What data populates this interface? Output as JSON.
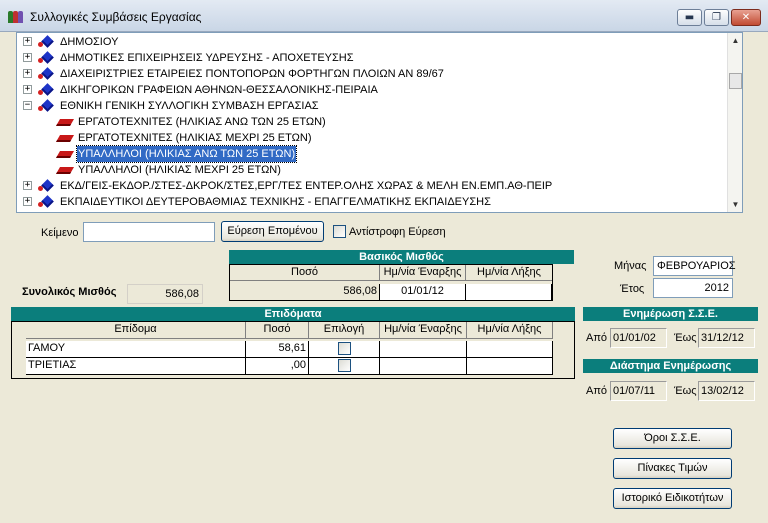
{
  "window": {
    "title": "Συλλογικές Συμβάσεις Εργασίας",
    "minimize": "▬",
    "restore": "❐",
    "close": "✕"
  },
  "tree": {
    "rows": [
      {
        "expander": "+",
        "icon": "diamond-icon",
        "label": "ΔΗΜΟΣΙΟΥ"
      },
      {
        "expander": "+",
        "icon": "diamond-icon",
        "label": "ΔΗΜΟΤΙΚΕΣ ΕΠΙΧΕΙΡΗΣΕΙΣ ΥΔΡΕΥΣΗΣ - ΑΠΟΧΕΤΕΥΣΗΣ"
      },
      {
        "expander": "+",
        "icon": "diamond-icon",
        "label": "ΔΙΑΧΕΙΡΙΣΤΡΙΕΣ ΕΤΑΙΡΕΙΕΣ ΠΟΝΤΟΠΟΡΩΝ ΦΟΡΤΗΓΩΝ ΠΛΟΙΩΝ ΑΝ 89/67"
      },
      {
        "expander": "+",
        "icon": "diamond-icon",
        "label": "ΔΙΚΗΓΟΡΙΚΩΝ ΓΡΑΦΕΙΩΝ ΑΘΗΝΩΝ-ΘΕΣΣΑΛΟΝΙΚΗΣ-ΠΕΙΡΑΙΑ"
      },
      {
        "expander": "−",
        "icon": "diamond-icon",
        "label": "ΕΘΝΙΚΗ ΓΕΝΙΚΗ ΣΥΛΛΟΓΙΚΗ ΣΥΜΒΑΣΗ ΕΡΓΑΣΙΑΣ"
      },
      {
        "expander": "",
        "icon": "book-icon",
        "label": "ΕΡΓΑΤΟΤΕΧΝΙΤΕΣ (ΗΛΙΚΙΑΣ ΑΝΩ ΤΩΝ 25 ΕΤΩΝ)"
      },
      {
        "expander": "",
        "icon": "book-icon",
        "label": "ΕΡΓΑΤΟΤΕΧΝΙΤΕΣ (ΗΛΙΚΙΑΣ ΜΕΧΡΙ 25 ΕΤΩΝ)"
      },
      {
        "expander": "",
        "icon": "book-icon",
        "label": "ΥΠΑΛΛΗΛΟΙ (ΗΛΙΚΙΑΣ ΑΝΩ ΤΩΝ 25 ΕΤΩΝ)",
        "selected": true
      },
      {
        "expander": "",
        "icon": "book-icon",
        "label": "ΥΠΑΛΛΗΛΟΙ (ΗΛΙΚΙΑΣ ΜΕΧΡΙ 25 ΕΤΩΝ)"
      },
      {
        "expander": "+",
        "icon": "diamond-icon",
        "label": "ΕΚΔ/ΓΕΙΣ-ΕΚΔΟΡ./ΣΤΕΣ-ΔΚΡΟΚ/ΣΤΕΣ,ΕΡΓ/ΤΕΣ ΕΝΤΕΡ.ΟΛΗΣ ΧΩΡΑΣ & ΜΕΛΗ ΕΝ.ΕΜΠ.ΑΘ-ΠΕΙΡ"
      },
      {
        "expander": "+",
        "icon": "diamond-icon",
        "label": "ΕΚΠΑΙΔΕΥΤΙΚΟΙ ΔΕΥΤΕΡΟΒΑΘΜΙΑΣ ΤΕΧΝΙΚΗΣ - ΕΠΑΓΓΕΛΜΑΤΙΚΗΣ ΕΚΠΑΙΔΕΥΣΗΣ"
      }
    ],
    "scroll_up": "▲",
    "scroll_down": "▼"
  },
  "search": {
    "label": "Κείμενο",
    "value": "",
    "find_next": "Εύρεση Επομένου",
    "reverse_label": "Αντίστροφη Εύρεση"
  },
  "total": {
    "label": "Συνολικός Μισθός",
    "value": "586,08"
  },
  "basic_salary": {
    "title": "Βασικός Μισθός",
    "headers": [
      "Ποσό",
      "Ημ/νία Έναρξης",
      "Ημ/νία Λήξης"
    ],
    "row": {
      "amount": "586,08",
      "start": "01/01/12",
      "end": ""
    }
  },
  "period": {
    "month_label": "Μήνας",
    "month_value": "ΦΕΒΡΟΥΑΡΙΟΣ",
    "year_label": "Έτος",
    "year_value": "2012"
  },
  "allowances": {
    "title": "Επιδόματα",
    "headers": [
      "Επίδομα",
      "Ποσό",
      "Επιλογή",
      "Ημ/νία Έναρξης",
      "Ημ/νία Λήξης"
    ],
    "rows": [
      {
        "name": "ΓΑΜΟΥ",
        "amount": "58,61",
        "start": "",
        "end": ""
      },
      {
        "name": "ΤΡΙΕΤΙΑΣ",
        "amount": ",00",
        "start": "",
        "end": ""
      }
    ]
  },
  "sse_update": {
    "title": "Ενημέρωση Σ.Σ.Ε.",
    "from_label": "Από",
    "from_value": "01/01/02",
    "to_label": "Έως",
    "to_value": "31/12/12"
  },
  "update_interval": {
    "title": "Διάστημα Ενημέρωσης",
    "from_label": "Από",
    "from_value": "01/07/11",
    "to_label": "Έως",
    "to_value": "13/02/12"
  },
  "buttons": {
    "terms": "Όροι Σ.Σ.Ε.",
    "price_tables": "Πίνακες Τιμών",
    "specialty_history": "Ιστορικό Ειδικοτήτων"
  },
  "colors": {
    "header_teal": "#0b7e7c",
    "selection": "#316ac5",
    "window_bg": "#ece9d8"
  }
}
